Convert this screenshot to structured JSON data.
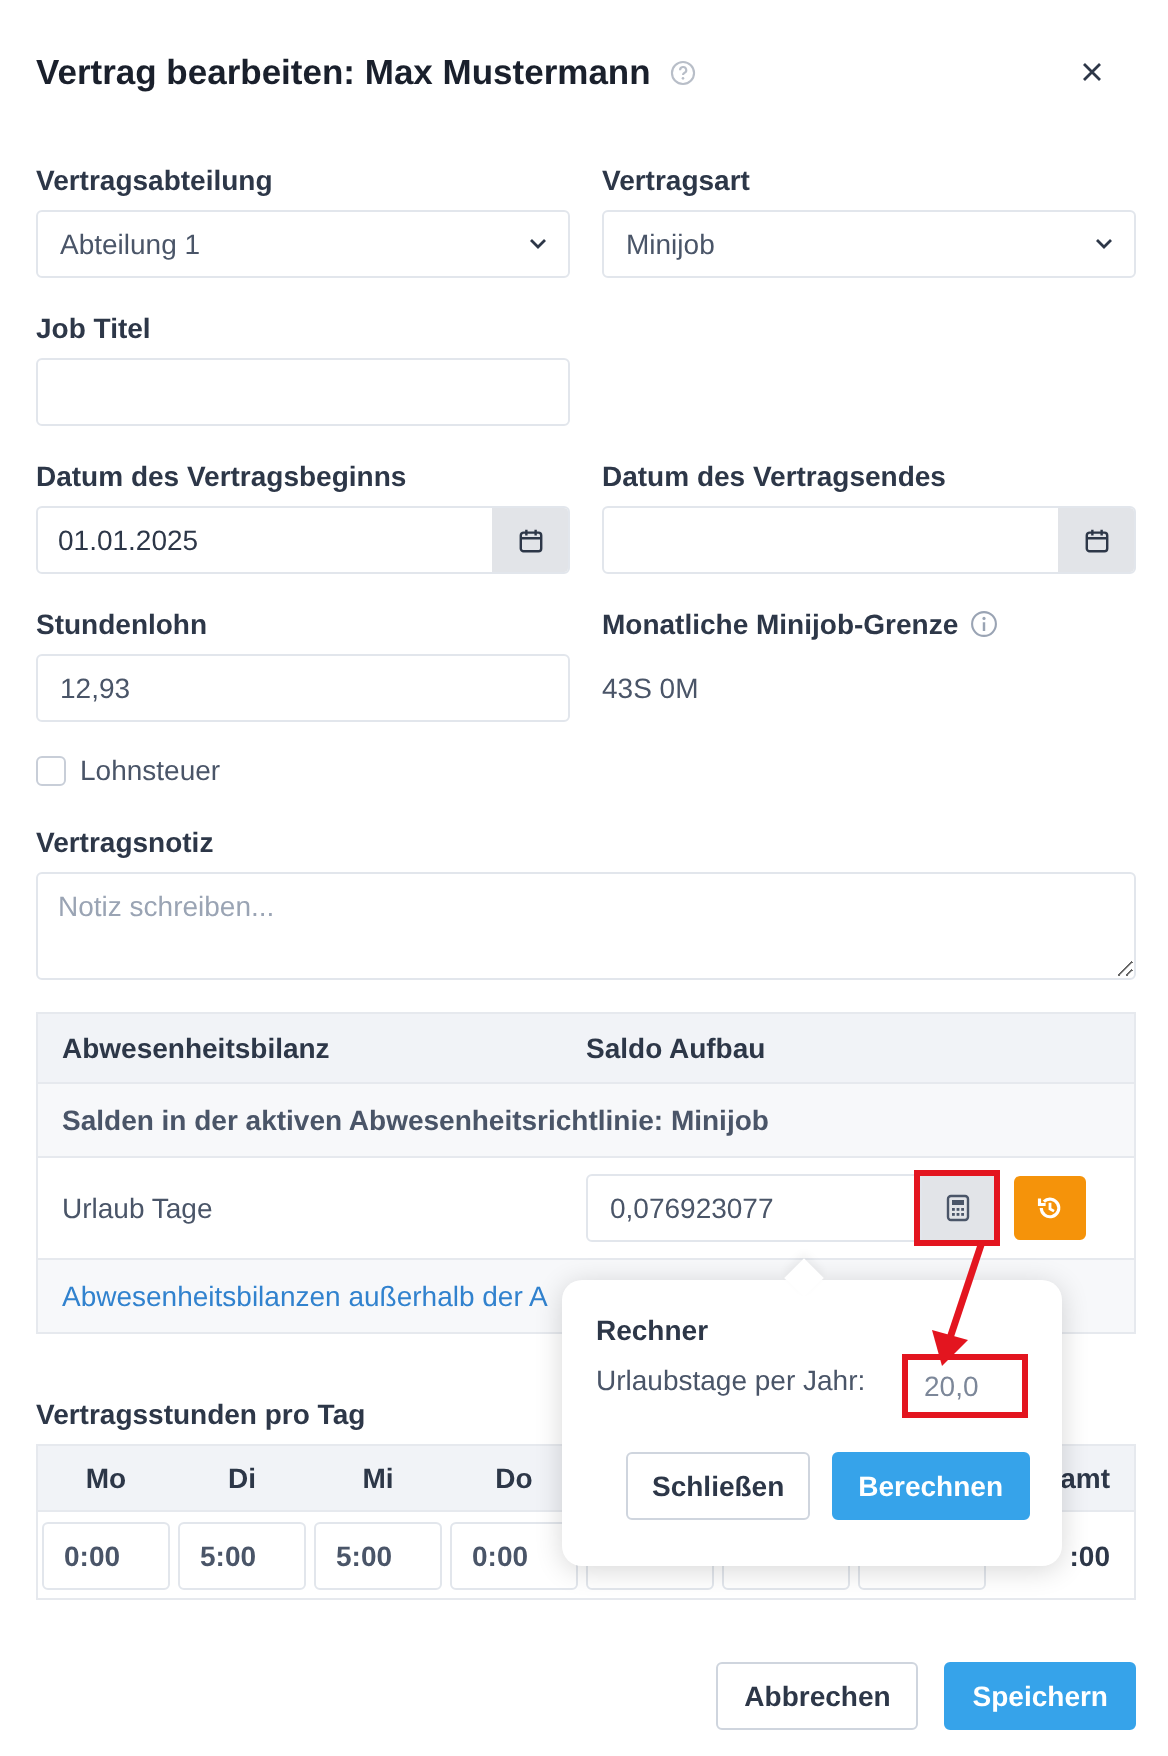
{
  "dialog": {
    "title": "Vertrag bearbeiten: Max Mustermann"
  },
  "form_rows": [
    [
      {
        "kind": "select",
        "label": "Vertragsabteilung",
        "value": "Abteilung 1"
      },
      {
        "kind": "select",
        "label": "Vertragsart",
        "value": "Minijob"
      }
    ],
    [
      {
        "kind": "text",
        "label": "Job Titel"
      }
    ],
    [
      {
        "kind": "date",
        "label": "Datum des Vertragsbeginns",
        "value": "01.01.2025"
      },
      {
        "kind": "date",
        "label": "Datum des Vertragsendes"
      }
    ],
    [
      {
        "kind": "text",
        "label": "Stundenlohn",
        "value": "12,93"
      },
      {
        "kind": "readout",
        "label": "Monatliche Minijob-Grenze",
        "has_info": true,
        "value": "43S 0M"
      }
    ]
  ],
  "tax_checkbox": {
    "label": "Lohnsteuer",
    "checked": false
  },
  "note": {
    "label": "Vertragsnotiz",
    "placeholder": "Notiz schreiben..."
  },
  "balance_table": {
    "columns": [
      "Abwesenheitsbilanz",
      "Saldo Aufbau"
    ],
    "section": "Salden in der aktiven Abwesenheitsrichtlinie: Minijob",
    "rows": [
      {
        "name": "Urlaub Tage",
        "value": "0,076923077",
        "calculator_highlighted": true
      }
    ],
    "link": "Abwesenheitsbilanzen außerhalb der A"
  },
  "hours": {
    "label": "Vertragsstunden pro Tag",
    "days": [
      {
        "kind": "input",
        "label": "Mo",
        "value": "0:00"
      },
      {
        "kind": "input",
        "label": "Di",
        "value": "5:00"
      },
      {
        "kind": "input",
        "label": "Mi",
        "value": "5:00"
      },
      {
        "kind": "input",
        "label": "Do",
        "value": "0:00"
      },
      {
        "kind": "covered"
      },
      {
        "kind": "covered"
      },
      {
        "kind": "covered"
      }
    ],
    "total": {
      "label": "amt",
      "value": ":00"
    }
  },
  "calculator_popover": {
    "title": "Rechner",
    "field_label": "Urlaubstage per Jahr:",
    "placeholder": "20,0",
    "highlighted": true,
    "buttons": [
      {
        "label": "Schließen",
        "kind": "secondary"
      },
      {
        "label": "Berechnen",
        "kind": "primary"
      }
    ]
  },
  "footer_buttons": [
    {
      "label": "Abbrechen",
      "kind": "secondary"
    },
    {
      "label": "Speichern",
      "kind": "primary"
    }
  ]
}
